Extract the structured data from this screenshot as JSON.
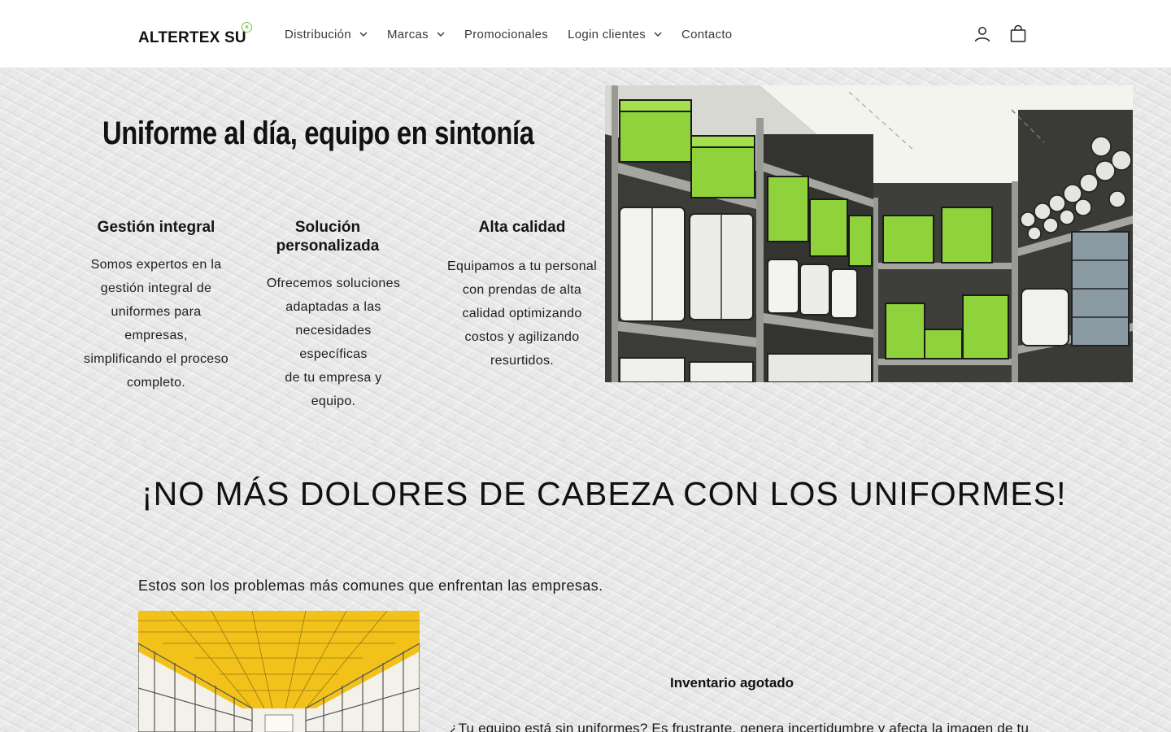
{
  "header": {
    "logo_text": "ALTERTEX SU",
    "nav": [
      {
        "label": "Distribución",
        "dropdown": true
      },
      {
        "label": "Marcas",
        "dropdown": true
      },
      {
        "label": "Promocionales",
        "dropdown": false
      },
      {
        "label": "Login clientes",
        "dropdown": true
      },
      {
        "label": "Contacto",
        "dropdown": false
      }
    ],
    "icons": [
      "account-icon",
      "cart-icon"
    ]
  },
  "hero": {
    "title": "Uniforme al día, equipo en sintonía",
    "features": [
      {
        "title": "Gestión integral",
        "text_lines": [
          "Somos expertos en la",
          "gestión integral de",
          "uniformes para",
          "empresas,",
          "simplificando el proceso",
          "completo."
        ]
      },
      {
        "title_lines": [
          "Solución",
          "personalizada"
        ],
        "text_lines": [
          "Ofrecemos soluciones",
          "adaptadas a las",
          "necesidades",
          "específicas",
          "de tu empresa y",
          "equipo."
        ]
      },
      {
        "title": "Alta calidad",
        "text_lines": [
          "Equipamos a tu personal",
          "con prendas de alta",
          "calidad optimizando",
          "costos y agilizando",
          "resurtidos."
        ]
      }
    ]
  },
  "problems": {
    "title": "¡NO MÁS DOLORES DE CABEZA CON LOS UNIFORMES!",
    "subtitle": "Estos son los problemas más comunes que enfrentan las empresas.",
    "card_title": "Inventario agotado",
    "card_text": "¿Tu equipo está sin uniformes? Es frustrante, genera incertidumbre y afecta la imagen de tu"
  },
  "colors": {
    "accent_green": "#8ccc3c",
    "warehouse_yellow": "#f2c21b",
    "text_dark": "#121212"
  }
}
